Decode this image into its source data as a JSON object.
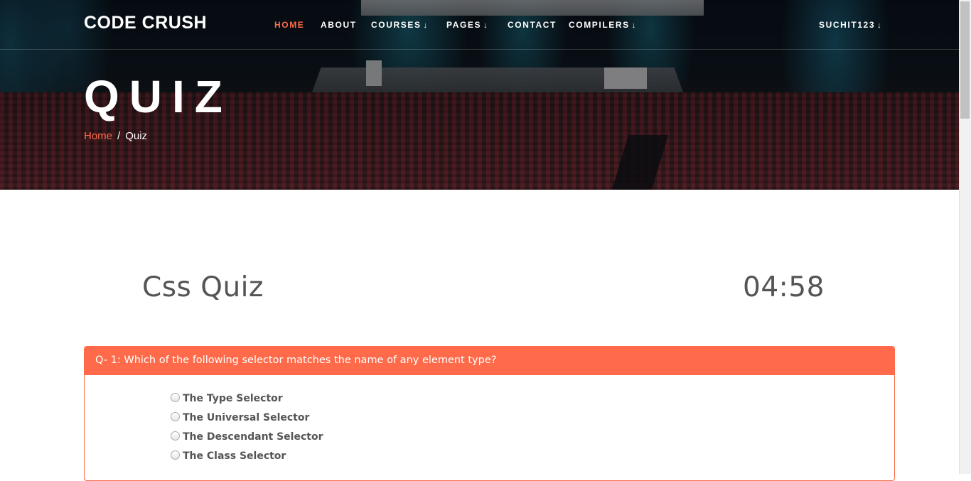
{
  "header": {
    "logo": "CODE CRUSH",
    "nav": [
      {
        "label": "HOME",
        "active": true,
        "dropdown": false
      },
      {
        "label": "ABOUT",
        "active": false,
        "dropdown": false
      },
      {
        "label": "COURSES",
        "active": false,
        "dropdown": true
      },
      {
        "label": "PAGES",
        "active": false,
        "dropdown": true
      },
      {
        "label": "CONTACT",
        "active": false,
        "dropdown": false
      },
      {
        "label": "COMPILERS",
        "active": false,
        "dropdown": true
      }
    ],
    "user": {
      "label": "SUCHIT123",
      "dropdown": true
    },
    "caret_glyph": "↓"
  },
  "hero": {
    "title": "QUIZ",
    "breadcrumb": {
      "home": "Home",
      "separator": "/",
      "current": "Quiz"
    }
  },
  "quiz": {
    "title": "Css Quiz",
    "timer": "04:58",
    "question": {
      "text": "Q- 1: Which of the following selector matches the name of any element type?",
      "options": [
        "The Type Selector",
        "The Universal Selector",
        "The Descendant Selector",
        "The Class Selector"
      ]
    }
  },
  "colors": {
    "accent": "#ff6b4a",
    "text_muted": "#555555"
  }
}
